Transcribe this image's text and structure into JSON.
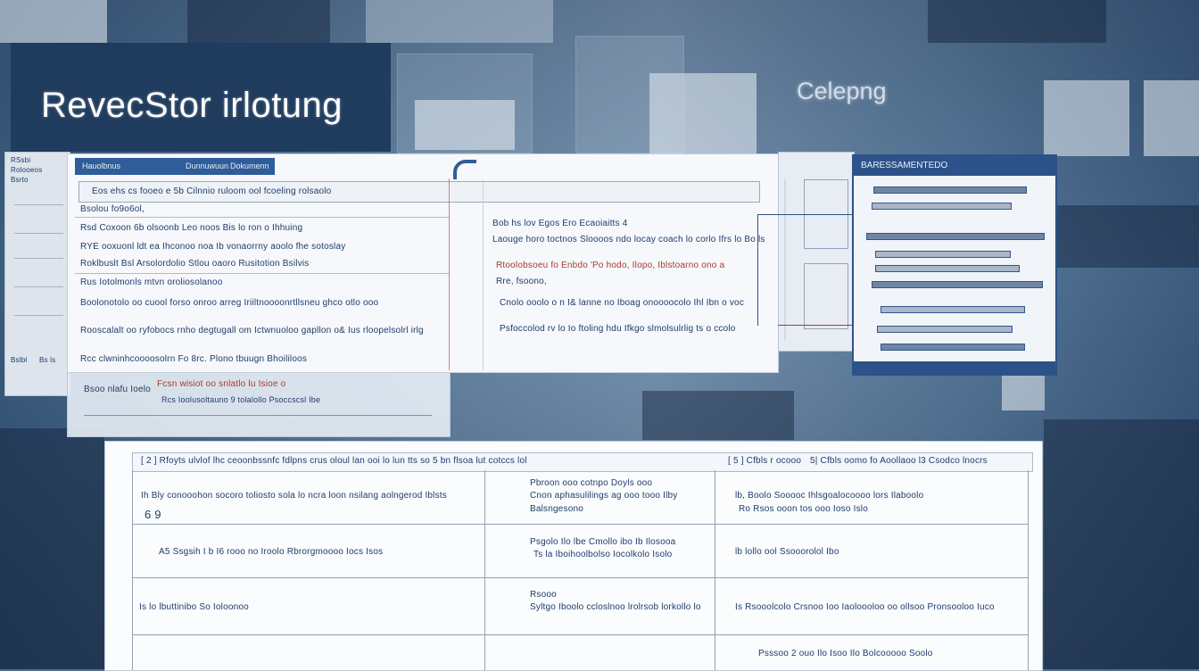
{
  "title": "RevecStor irlotung",
  "corner_label": "Celepng",
  "main_doc": {
    "tab1": "Hauolbnus",
    "tab2": "Dunnuwuun",
    "tab3": "Dokumenn",
    "search_row": "Eos ehs cs fooeo e 5b Cilnnio ruloom ool fcoeling rolsaolo",
    "left_lines": [
      "Bsolou fo9o6ol,",
      "Rsd Coxoon 6b olsoonb Leo noos Bis lo ron o Ihhuing",
      "RYE ooxuonl ldt ea Ihconoo noa Ib vonaorrny aoolo fhe sotoslay",
      "Roklbuslt Bsl Arsolordolio Stlou oaoro Rusitotion Bsilvis",
      "Rus Iotolmonls mtvn oroliosolanoo",
      "Boolonotolo oo cuool forso onroo arreg Iriiltnoooonrtllsneu ghco otlo ooo",
      "Rooscalalt oo ryfobocs rnho degtugall om Ictwnuoloo gapllon o& Ius rloopelsolrl irlg",
      "Rcc clwninhcoooosolrn Fo 8rc. Plono tbuugn Bhoililoos"
    ],
    "right_lines": [
      "Bob hs lov Egos Ero Ecaoiaitts 4",
      "Laouge horo toctnos Sloooos ndo locay coach lo corlo Ifrs lo Bo ls",
      "Rtoolobsoeu fo Enbdo 'Po hodo, Ilopo, Iblstoarno ono a",
      "Rre, fsoono,",
      "Cnolo ooolo o n I& lanne no Iboag onoooocolo Ihl Ibn o voc",
      "Psfoccolod rv lo Io ftoling hdu Ifkgo slmolsulrlig ts o ccolo"
    ],
    "left_red_line": "Fcsn wisiot oo snlatlo lu Isioe o",
    "left_small_1": "Bsoo nlafu Ioelo",
    "left_small_2": "Rcs Ioolusoltauno 9 tolalollo Psoccscsl Ibe"
  },
  "left_doc": {
    "items": [
      "RSsbi",
      "Rolooeos",
      "Bsrto",
      "Bslbl",
      "Bs ls"
    ]
  },
  "right_doc": {
    "header": "BARESSAMENTEDO"
  },
  "table": {
    "header_cells": [
      "[ 2 ] Rfoyts ulvlof lhc ceoonbssnfc fdlpns crus oloul lan ooi lo lun tts so 5 bn flsoa lut cotccs lol",
      "[ 5 ] Cfbls r ocooo",
      "5| Cfbls oomo fo Aoollaoo l3 Csodco lnocrs"
    ],
    "rows": [
      {
        "c1": "Ih Bly conooohon socoro toliosto sola lo ncra loon nsilang aolngerod Iblsts",
        "c1b": "6 9",
        "c2": "Pbroon ooo cotnpo Doyls ooo",
        "c2b": "Cnon aphasulilings ag ooo tooo Ilby",
        "c2c": "Balsngesono",
        "c3": "lb, Boolo Sooooc Ihlsgoalocoooo lors Ilaboolo",
        "c3b": "Ro Rsos ooon tos ooo Ioso Islo"
      },
      {
        "c1": "A5 Ssgsih I b I6 rooo no Iroolo Rbrorgmoooo Iocs Isos",
        "c2": "Psgolo Ilo lbe Cmollo ibo Ib Ilosooa",
        "c2b": "Ts la Iboihoolbolso Iocolkolo Isolo",
        "c3": "lb lollo ool Ssooorolol Ibo"
      },
      {
        "c1": "Is lo lbuttinibo So Ioloonoo",
        "c2": "Rsooo",
        "c2b": "Syltgo Iboolo ccloslnoo lrolrsob lorkollo lo",
        "c3": "Is Rsooolcolo Crsnoo Ioo Iaoloooloo oo ollsoo Pronsooloo Iuco"
      },
      {
        "c3": "Psssoo 2 ouo Ilo Isoo Ilo Bolcooooo Soolo"
      }
    ]
  }
}
